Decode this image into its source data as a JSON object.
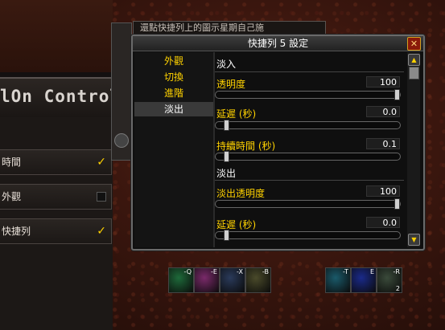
{
  "tooltip": "還點快捷列上的圖示星期自己施",
  "addon": {
    "title": "lOn Controll",
    "rows": [
      {
        "label": "時間",
        "checked": true
      },
      {
        "label": "外觀",
        "checked": false
      },
      {
        "label": "快捷列",
        "checked": true
      }
    ]
  },
  "dialog": {
    "title": "快捷列 5 設定",
    "close_label": "✕",
    "nav": [
      "外觀",
      "切換",
      "進階",
      "淡出"
    ],
    "active_nav": "淡出",
    "sections": [
      {
        "heading": "淡入",
        "settings": [
          {
            "label": "透明度",
            "value": "100",
            "fraction": 1.0
          },
          {
            "label": "延遲 (秒)",
            "value": "0.0",
            "fraction": 0.0
          },
          {
            "label": "持續時間 (秒)",
            "value": "0.1",
            "fraction": 0.0
          }
        ]
      },
      {
        "heading": "淡出",
        "settings": [
          {
            "label": "淡出透明度",
            "value": "100",
            "fraction": 1.0
          },
          {
            "label": "延遲 (秒)",
            "value": "0.0",
            "fraction": 0.0
          }
        ]
      }
    ]
  },
  "action_bar": [
    {
      "key": "-Q",
      "count": "",
      "color": "#1e6a3a"
    },
    {
      "key": "-E",
      "count": "",
      "color": "#7a2a6a"
    },
    {
      "key": "-X",
      "count": "",
      "color": "#2a3a5a"
    },
    {
      "key": "-B",
      "count": "",
      "color": "#4a4a2a"
    },
    {
      "key": "-T",
      "count": "",
      "color": "#1a5a6a"
    },
    {
      "key": "E",
      "count": "",
      "color": "#1a2a8a"
    },
    {
      "key": "-R",
      "count": "2",
      "color": "#3a4a3a"
    }
  ],
  "colors": {
    "accent": "#ffd200",
    "close": "#8a1a0a"
  }
}
